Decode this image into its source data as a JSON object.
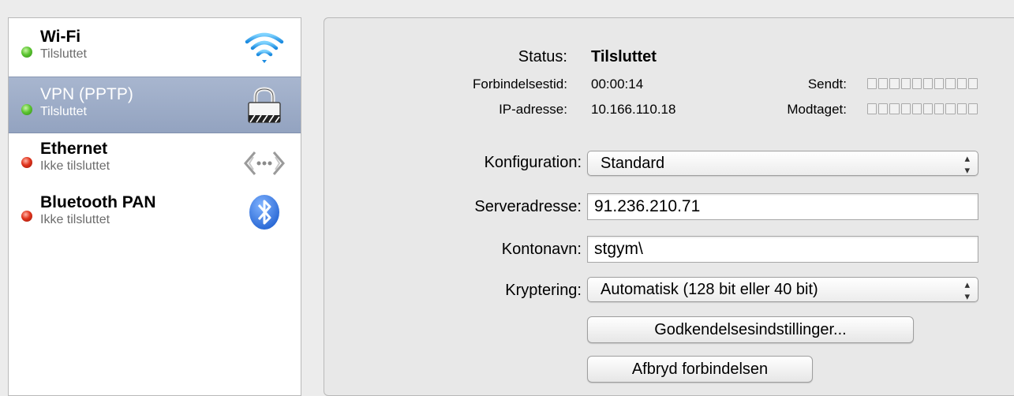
{
  "services": [
    {
      "name": "Wi-Fi",
      "status": "Tilsluttet",
      "indicator": "green",
      "icon": "wifi-icon",
      "selected": false
    },
    {
      "name": "VPN (PPTP)",
      "status": "Tilsluttet",
      "indicator": "green",
      "icon": "lock-icon",
      "selected": true
    },
    {
      "name": "Ethernet",
      "status": "Ikke tilsluttet",
      "indicator": "red",
      "icon": "ethernet-icon",
      "selected": false
    },
    {
      "name": "Bluetooth PAN",
      "status": "Ikke tilsluttet",
      "indicator": "red",
      "icon": "bluetooth-icon",
      "selected": false
    }
  ],
  "details": {
    "status_label": "Status:",
    "status_value": "Tilsluttet",
    "connect_time_label": "Forbindelsestid:",
    "connect_time_value": "00:00:14",
    "ip_label": "IP-adresse:",
    "ip_value": "10.166.110.18",
    "sent_label": "Sendt:",
    "received_label": "Modtaget:"
  },
  "form": {
    "config_label": "Konfiguration:",
    "config_value": "Standard",
    "server_label": "Serveradresse:",
    "server_value": "91.236.210.71",
    "account_label": "Kontonavn:",
    "account_value": "stgym\\",
    "encryption_label": "Kryptering:",
    "encryption_value": "Automatisk (128 bit eller 40 bit)",
    "auth_button": "Godkendelsesindstillinger...",
    "disconnect_button": "Afbryd forbindelsen"
  },
  "colors": {
    "selection": "#9aa9c4",
    "indicator_green": "#4fbf2a",
    "indicator_red": "#d8321b",
    "bluetooth": "#2f6fd8"
  }
}
